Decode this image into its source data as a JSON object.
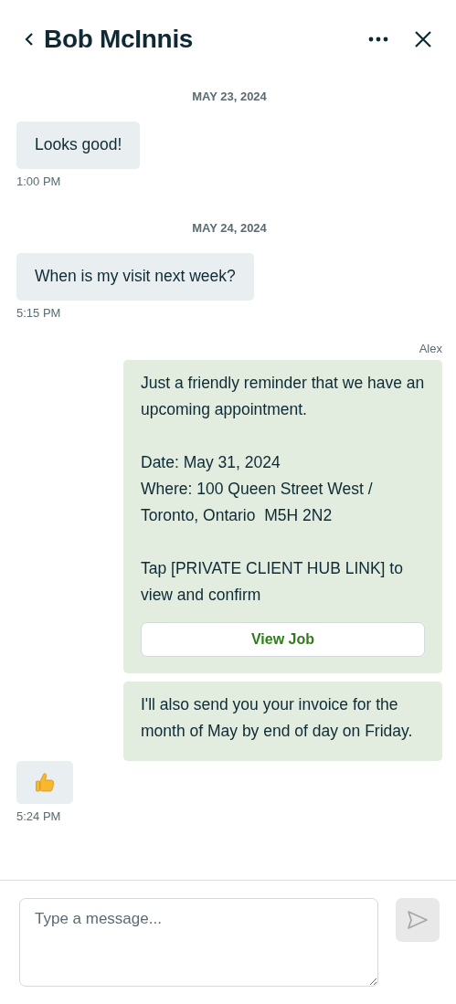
{
  "header": {
    "title": "Bob McInnis"
  },
  "thread": [
    {
      "kind": "date",
      "text": "MAY 23, 2024"
    },
    {
      "kind": "incoming",
      "messages": [
        {
          "kind": "text",
          "text": "Looks good!"
        }
      ],
      "time": "1:00 PM"
    },
    {
      "kind": "date",
      "text": "MAY 24, 2024"
    },
    {
      "kind": "incoming",
      "messages": [
        {
          "kind": "text",
          "text": "When is my visit next week?"
        }
      ],
      "time": "5:15 PM"
    },
    {
      "kind": "outgoing",
      "sender": "Alex",
      "messages": [
        {
          "kind": "text",
          "text": "Just a friendly reminder that we have an upcoming appointment.\n\nDate: May 31, 2024\nWhere: 100 Queen Street West / Toronto, Ontario  M5H 2N2\n\nTap [PRIVATE CLIENT HUB LINK] to view and confirm",
          "button": "View Job"
        },
        {
          "kind": "text",
          "text": "I'll also send you your invoice for the month of May by end of day on Friday."
        }
      ]
    },
    {
      "kind": "incoming",
      "messages": [
        {
          "kind": "reaction"
        }
      ],
      "time": "5:24 PM"
    }
  ],
  "composer": {
    "placeholder": "Type a message..."
  }
}
